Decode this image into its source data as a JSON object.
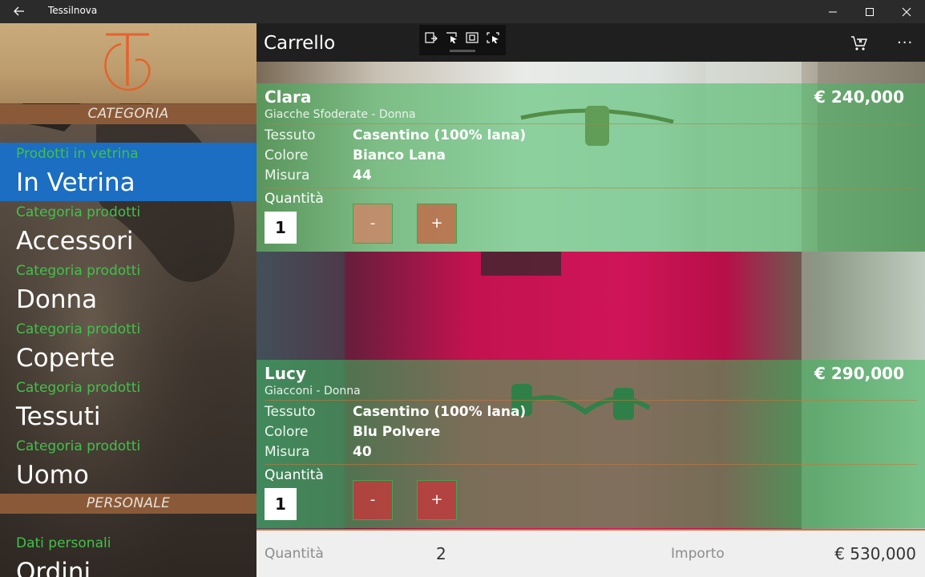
{
  "window": {
    "app_title": "Tessilnova"
  },
  "nav": {
    "section_categoria": "CATEGORIA",
    "section_personale": "PERSONALE",
    "items": [
      {
        "sub": "Prodotti in vetrina",
        "label": "In Vetrina",
        "selected": true
      },
      {
        "sub": "Categoria prodotti",
        "label": "Accessori",
        "selected": false
      },
      {
        "sub": "Categoria prodotti",
        "label": "Donna",
        "selected": false
      },
      {
        "sub": "Categoria prodotti",
        "label": "Coperte",
        "selected": false
      },
      {
        "sub": "Categoria prodotti",
        "label": "Tessuti",
        "selected": false
      },
      {
        "sub": "Categoria prodotti",
        "label": "Uomo",
        "selected": false
      }
    ],
    "personal_items": [
      {
        "sub": "Dati personali",
        "label": "Ordini"
      }
    ]
  },
  "page": {
    "title": "Carrello"
  },
  "cart": {
    "labels": {
      "fabric": "Tessuto",
      "color": "Colore",
      "size": "Misura",
      "quantity": "Quantità",
      "minus": "-",
      "plus": "+"
    },
    "items": [
      {
        "name": "Clara",
        "price": "€ 240,000",
        "category": "Giacche Sfoderate - Donna",
        "fabric": "Casentino (100% lana)",
        "color": "Bianco Lana",
        "size": "44",
        "quantity": "1"
      },
      {
        "name": "Lucy",
        "price": "€ 290,000",
        "category": "Giacconi - Donna",
        "fabric": "Casentino (100% lana)",
        "color": "Blu Polvere",
        "size": "40",
        "quantity": "1"
      }
    ]
  },
  "summary": {
    "quantity_label": "Quantità",
    "quantity_value": "2",
    "total_label": "Importo",
    "total_value": "€ 530,000"
  },
  "colors": {
    "accent_blue": "#1b6ec2",
    "nav_green": "#41c14b",
    "section_brown": "#8a5a38",
    "overlay_green": "#40ba60",
    "summary_accent": "#d86b34"
  }
}
